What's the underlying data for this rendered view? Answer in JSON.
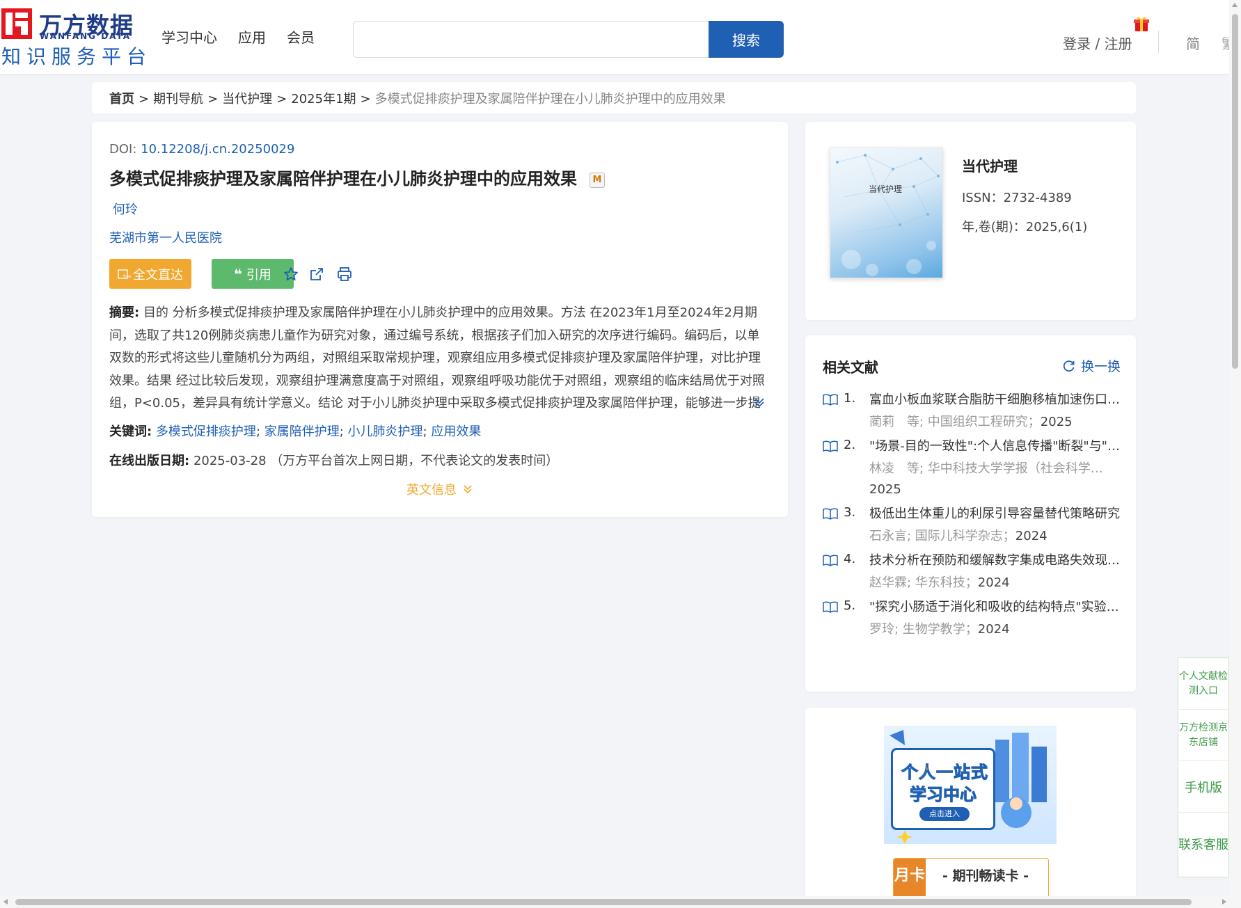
{
  "header": {
    "logo_cn": "万方数据",
    "logo_en": "WANFANG DATA",
    "logo_sub": "知识服务平台",
    "nav": [
      "学习中心",
      "应用",
      "会员"
    ],
    "search": {
      "placeholder": "",
      "button": "搜索"
    },
    "login": "登录 / 注册",
    "lang_simplified": "简",
    "lang_traditional": "繁"
  },
  "breadcrumb": {
    "home": "首页",
    "items": [
      "期刊导航",
      "当代护理",
      "2025年1期"
    ],
    "current": "多模式促排痰护理及家属陪伴护理在小儿肺炎护理中的应用效果",
    "sep": ">"
  },
  "article": {
    "doi_label": "DOI:",
    "doi": "10.12208/j.cn.20250029",
    "title": "多模式促排痰护理及家属陪伴护理在小儿肺炎护理中的应用效果",
    "badge": "M",
    "author": "何玲",
    "org": "芜湖市第一人民医院",
    "btn_full": "全文直达",
    "btn_cite": "引用",
    "abstract_label": "摘要:",
    "abstract": "目的 分析多模式促排痰护理及家属陪伴护理在小儿肺炎护理中的应用效果。方法 在2023年1月至2024年2月期间，选取了共120例肺炎病患儿童作为研究对象，通过编号系统，根据孩子们加入研究的次序进行编码。编码后，以单双数的形式将这些儿童随机分为两组，对照组采取常规护理，观察组应用多模式促排痰护理及家属陪伴护理，对比护理效果。结果 经过比较后发现，观察组护理满意度高于对照组，观察组呼吸功能优于对照组，观察组的临床结局优于对照组，P<0.05，差异具有统计学意义。结论 对于小儿肺炎护理中采取多模式促排痰护理及家属陪伴护理，能够进一步提升护理应用效果...",
    "keywords_label": "关键词:",
    "keywords": [
      "多模式促排痰护理",
      "家属陪伴护理",
      "小儿肺炎护理",
      "应用效果"
    ],
    "pubdate_label": "在线出版日期:",
    "pubdate": "2025-03-28",
    "pubdate_note": "（万方平台首次上网日期，不代表论文的发表时间）",
    "en_info": "英文信息"
  },
  "journal": {
    "name": "当代护理",
    "cover_title": "当代护理",
    "issn": "ISSN：2732-4389",
    "volume": "年,卷(期)：2025,6(1)"
  },
  "related": {
    "heading": "相关文献",
    "refresh": "换一换",
    "items": [
      {
        "num": "1.",
        "title": "富血小板血浆联合脂肪干细胞移植加速伤口愈合的研究",
        "meta": "蔺莉　等; 中国组织工程研究；",
        "year": "2025"
      },
      {
        "num": "2.",
        "title": "\"场景-目的一致性\":个人信息传播\"断裂\"与\"重组\"",
        "meta": "林凌　等; 华中科技大学学报（社会科学版）；",
        "year": "2025"
      },
      {
        "num": "3.",
        "title": "极低出生体重儿的利尿引导容量替代策略研究",
        "meta": "石永言; 国际儿科学杂志；",
        "year": "2024"
      },
      {
        "num": "4.",
        "title": "技术分析在预防和缓解数字集成电路失效现象中的应用",
        "meta": "赵华霖; 华东科技；",
        "year": "2024"
      },
      {
        "num": "5.",
        "title": "\"探究小肠适于消化和吸收的结构特点\"实验教学设计",
        "meta": "罗玲; 生物学教学；",
        "year": "2024"
      }
    ]
  },
  "ads": {
    "banner_line1": "个人一站式",
    "banner_line2": "学习中心",
    "banner_btn": "点击进入",
    "card_month": "月卡",
    "card_title": "- 期刊畅读卡 -"
  },
  "float": {
    "item1": "个人文献检测入口",
    "item2": "万方检测京东店铺",
    "item3": "手机版",
    "item4": "联系客服"
  },
  "colors": {
    "brand": "#1f5fb4",
    "accent_orange": "#f0a830",
    "accent_green": "#5dba6c",
    "logo_red": "#e4161f"
  }
}
